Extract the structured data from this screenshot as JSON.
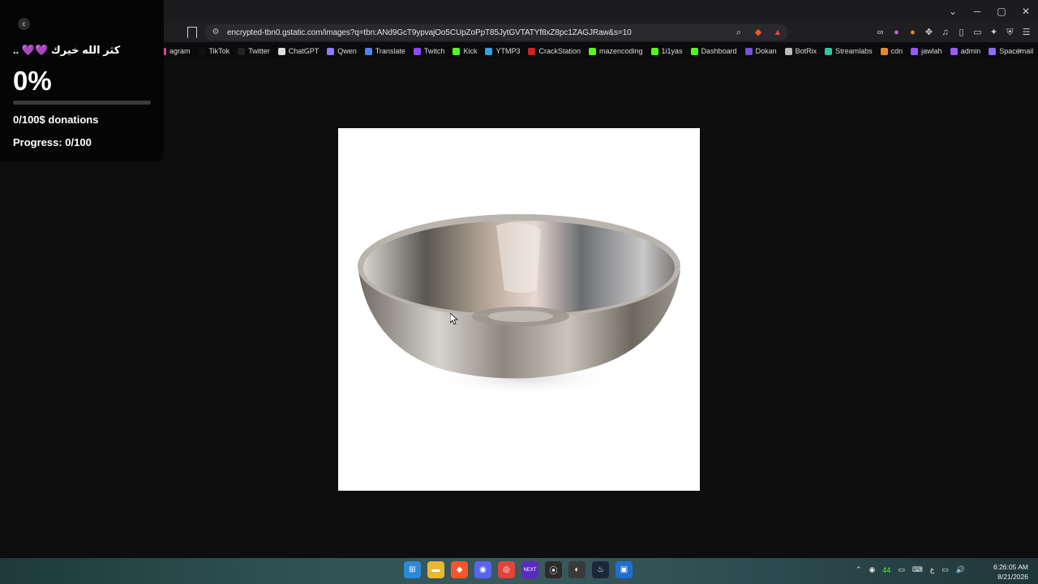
{
  "window": {
    "controls": [
      "⌄",
      "─",
      "▢",
      "✕"
    ]
  },
  "address_bar": {
    "url": "encrypted-tbn0.gstatic.com/images?q=tbn:ANd9GcT9ypvajOo5CUpZoPpT85JytGVTATYf8xZ8pc1ZAGJRaw&s=10"
  },
  "bookmarks": [
    {
      "label": "agram",
      "color": "#d14b8f"
    },
    {
      "label": "TikTok",
      "color": "#111111"
    },
    {
      "label": "Twitter",
      "color": "#222222"
    },
    {
      "label": "ChatGPT",
      "color": "#dddddd"
    },
    {
      "label": "Qwen",
      "color": "#8e7bff"
    },
    {
      "label": "Translate",
      "color": "#4a86f0"
    },
    {
      "label": "Twitch",
      "color": "#9146ff"
    },
    {
      "label": "Kick",
      "color": "#53fc18"
    },
    {
      "label": "YTMP3",
      "color": "#2aa7e0"
    },
    {
      "label": "CrackStation",
      "color": "#cc2222"
    },
    {
      "label": "mazencoding",
      "color": "#53fc18"
    },
    {
      "label": "1i1yas",
      "color": "#53fc18"
    },
    {
      "label": "Dashboard",
      "color": "#53fc18"
    },
    {
      "label": "Dokan",
      "color": "#7a4fd6"
    },
    {
      "label": "BotRix",
      "color": "#bbbbbb"
    },
    {
      "label": "Streamlabs",
      "color": "#31c3a2"
    },
    {
      "label": "cdn",
      "color": "#e58a2b"
    },
    {
      "label": "jawlah",
      "color": "#9b59ff"
    },
    {
      "label": "admin",
      "color": "#9b59ff"
    },
    {
      "label": "Spacemail",
      "color": "#8e6bff"
    }
  ],
  "overlay": {
    "logo": "c",
    "heading": "كثر الله خيرك 💜💜 ..",
    "percent_text": "0%",
    "progress_fraction": 0,
    "donations_text": "0/100$ donations",
    "progress_text": "Progress: 0/100",
    "accent": "#9b59ff"
  },
  "image": {
    "subject": "stainless steel mixing bowl"
  },
  "tray": {
    "badge": "44",
    "keyboard": "ع"
  },
  "clock": {
    "time": "6:26:05 AM",
    "date": "8/21/2026"
  }
}
